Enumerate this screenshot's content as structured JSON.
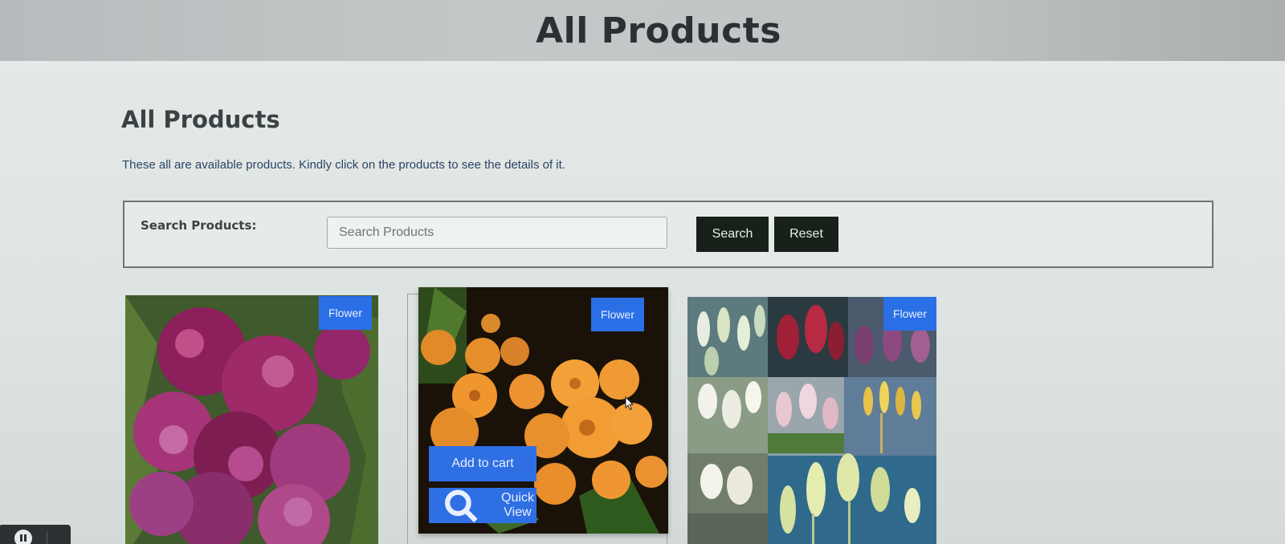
{
  "header": {
    "title": "All Products"
  },
  "main": {
    "title": "All Products",
    "description": "These all are available products. Kindly click on the products to see the details of it."
  },
  "search": {
    "label": "Search Products:",
    "placeholder": "Search Products",
    "search_button": "Search",
    "reset_button": "Reset"
  },
  "products": [
    {
      "tag": "Flower",
      "image": "purple-lilac-flowers"
    },
    {
      "tag": "Flower",
      "image": "orange-star-flowers",
      "add_to_cart": "Add to cart",
      "quick_view": "Quick View"
    },
    {
      "tag": "Flower",
      "image": "bunny-tail-grass-collage"
    }
  ],
  "colors": {
    "accent_blue": "#2a6fe6",
    "dark_button": "#172119",
    "header_bg": "#bfc4c4"
  }
}
